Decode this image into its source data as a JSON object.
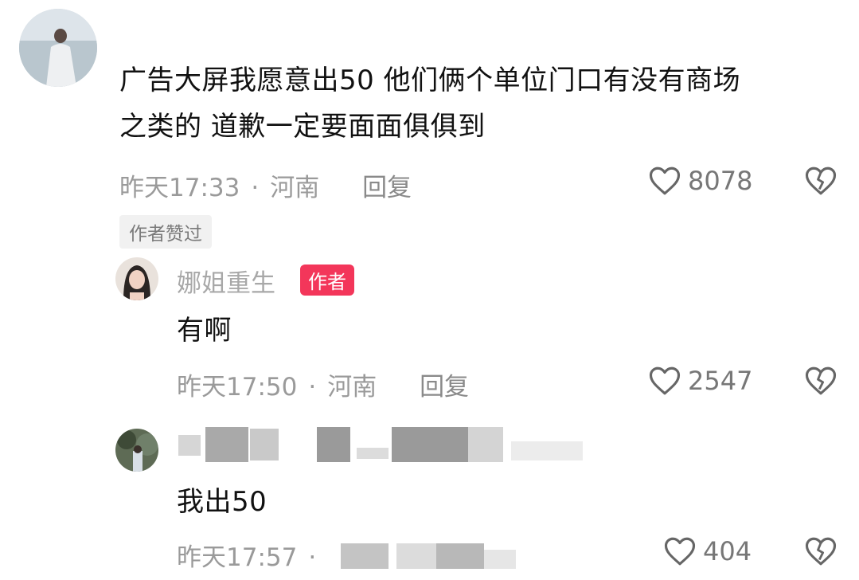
{
  "comment_main": {
    "text_line1": "广告大屏我愿意出50 他们俩个单位门口有没有商场",
    "text_line2": "之类的 道歉一定要面面俱俱到",
    "time": "昨天17:33",
    "location": "河南",
    "reply_label": "回复",
    "likes": "8078",
    "tag": "作者赞过"
  },
  "reply_author": {
    "username": "娜姐重生",
    "badge": "作者",
    "text": "有啊",
    "time": "昨天17:50",
    "location": "河南",
    "reply_label": "回复",
    "likes": "2547"
  },
  "reply_other": {
    "text": "我出50",
    "time": "昨天17:57",
    "likes": "404"
  },
  "colors": {
    "badge_red": "#f3365a",
    "meta_gray": "#9a9a9a"
  },
  "icons": {
    "like": "heart-outline-icon",
    "dislike": "broken-heart-icon"
  }
}
